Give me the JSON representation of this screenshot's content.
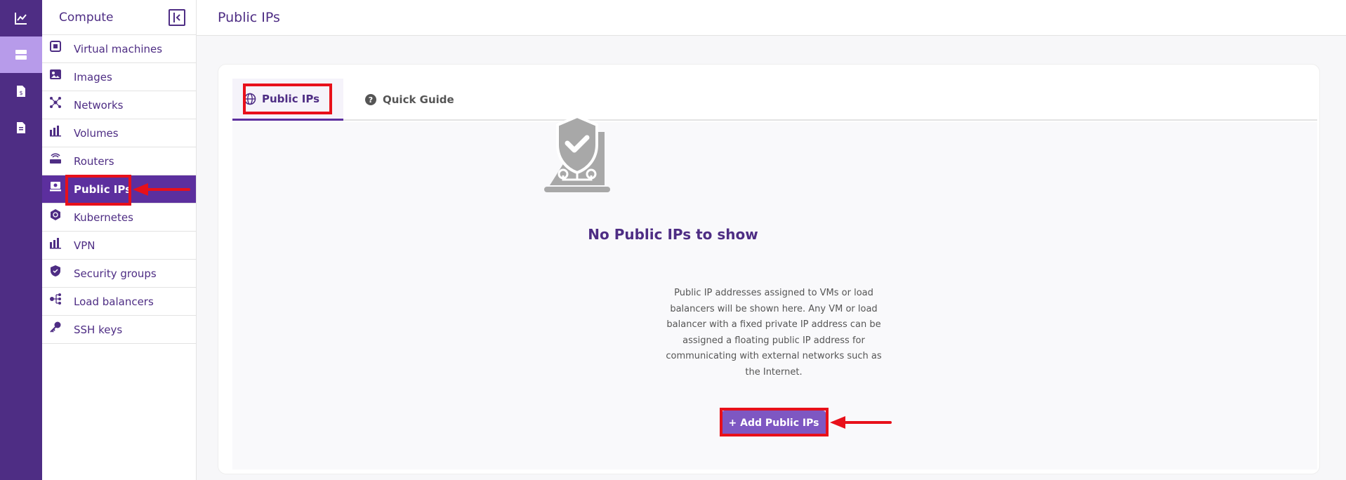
{
  "colors": {
    "brand": "#4e2d84",
    "rail_active": "#b79bea",
    "nav_active": "#5c2f9e",
    "button": "#7e57c2",
    "annotation": "#e8101a"
  },
  "rail": {
    "items": [
      {
        "icon": "chart-line-icon"
      },
      {
        "icon": "server-icon"
      },
      {
        "icon": "billing-document-icon"
      },
      {
        "icon": "document-icon"
      }
    ]
  },
  "sidebar": {
    "title": "Compute",
    "collapse_icon": "collapse-sidebar-icon",
    "items": [
      {
        "label": "Virtual machines",
        "icon": "virtual-machine-icon"
      },
      {
        "label": "Images",
        "icon": "image-icon"
      },
      {
        "label": "Networks",
        "icon": "network-icon"
      },
      {
        "label": "Volumes",
        "icon": "volume-icon"
      },
      {
        "label": "Routers",
        "icon": "router-icon"
      },
      {
        "label": "Public IPs",
        "icon": "public-ip-icon"
      },
      {
        "label": "Kubernetes",
        "icon": "kubernetes-icon"
      },
      {
        "label": "VPN",
        "icon": "vpn-icon"
      },
      {
        "label": "Security groups",
        "icon": "shield-icon"
      },
      {
        "label": "Load balancers",
        "icon": "load-balancer-icon"
      },
      {
        "label": "SSH keys",
        "icon": "key-icon"
      }
    ],
    "active_item": "Public IPs"
  },
  "header": {
    "title": "Public IPs"
  },
  "tabs": [
    {
      "label": "Public IPs",
      "icon": "globe-icon"
    },
    {
      "label": "Quick Guide",
      "icon": "question-circle-icon"
    }
  ],
  "empty_state": {
    "icon": "shield-laptop-icon",
    "title": "No Public IPs to show",
    "description": "Public IP addresses assigned to VMs or load balancers will be shown here. Any VM or load balancer with a fixed private IP address can be assigned a floating public IP address for communicating with external networks such as the Internet.",
    "button_label": "+ Add Public IPs"
  }
}
